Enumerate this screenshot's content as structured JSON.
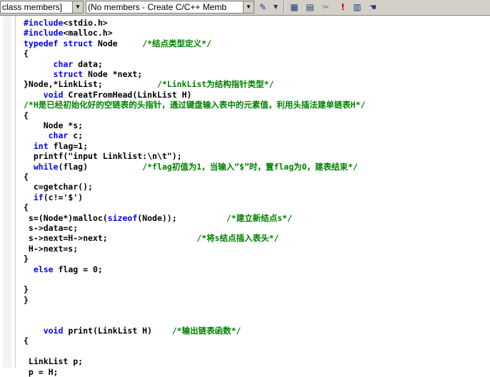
{
  "toolbar": {
    "class_combo": "class members]",
    "members_combo": "(No members - Create C/C++ Memb",
    "icons": [
      "wizard-icon",
      "dropdown-icon",
      "workspace-icon",
      "classwizard-icon",
      "stop-build-icon",
      "exclamation-icon",
      "report-icon",
      "hand-icon"
    ]
  },
  "colors": {
    "keyword": "#0000ff",
    "comment": "#008000",
    "text": "#000000"
  },
  "code_lines": [
    [
      {
        "t": "#include",
        "k": "kw"
      },
      {
        "t": "<stdio.h>"
      }
    ],
    [
      {
        "t": "#include",
        "k": "kw"
      },
      {
        "t": "<malloc.h>"
      }
    ],
    [
      {
        "t": "typedef",
        "k": "kw"
      },
      {
        "t": " "
      },
      {
        "t": "struct",
        "k": "kw"
      },
      {
        "t": " Node     "
      },
      {
        "t": "/*结点类型定义*/",
        "k": "cm"
      }
    ],
    [
      {
        "t": "{"
      }
    ],
    [
      {
        "t": "      "
      },
      {
        "t": "char",
        "k": "kw"
      },
      {
        "t": " data;"
      }
    ],
    [
      {
        "t": "      "
      },
      {
        "t": "struct",
        "k": "kw"
      },
      {
        "t": " Node *next;"
      }
    ],
    [
      {
        "t": "}Node,*LinkList;           "
      },
      {
        "t": "/*LinkList为结构指针类型*/",
        "k": "cm"
      }
    ],
    [
      {
        "t": "    "
      },
      {
        "t": "void",
        "k": "kw"
      },
      {
        "t": " CreatFromHead(LinkList H)"
      }
    ],
    [
      {
        "t": "/*H是已经初始化好的空链表的头指针，通过键盘输入表中的元素值，利用头插法建单链表H*/",
        "k": "cm"
      }
    ],
    [
      {
        "t": "{"
      }
    ],
    [
      {
        "t": "    Node *s;"
      }
    ],
    [
      {
        "t": "     "
      },
      {
        "t": "char",
        "k": "kw"
      },
      {
        "t": " c;"
      }
    ],
    [
      {
        "t": "  "
      },
      {
        "t": "int",
        "k": "kw"
      },
      {
        "t": " flag=1;"
      }
    ],
    [
      {
        "t": "  printf(\"input Linklist:\\n\\t\");"
      }
    ],
    [
      {
        "t": "  "
      },
      {
        "t": "while",
        "k": "kw"
      },
      {
        "t": "(flag)           "
      },
      {
        "t": "/*flag初值为1，当输入“$”时，置flag为0，建表结束*/",
        "k": "cm"
      }
    ],
    [
      {
        "t": "{"
      }
    ],
    [
      {
        "t": "  c=getchar();"
      }
    ],
    [
      {
        "t": "  "
      },
      {
        "t": "if",
        "k": "kw"
      },
      {
        "t": "(c!='$')"
      }
    ],
    [
      {
        "t": "{"
      }
    ],
    [
      {
        "t": " s=(Node*)malloc("
      },
      {
        "t": "sizeof",
        "k": "kw"
      },
      {
        "t": "(Node));          "
      },
      {
        "t": "/*建立新结点s*/",
        "k": "cm"
      }
    ],
    [
      {
        "t": " s->data=c;"
      }
    ],
    [
      {
        "t": " s->next=H->next;                  "
      },
      {
        "t": "/*将s结点插入表头*/",
        "k": "cm"
      }
    ],
    [
      {
        "t": " H->next=s;"
      }
    ],
    [
      {
        "t": "}"
      }
    ],
    [
      {
        "t": "  "
      },
      {
        "t": "else",
        "k": "kw"
      },
      {
        "t": " flag = 0;"
      }
    ],
    [],
    [
      {
        "t": "}"
      }
    ],
    [
      {
        "t": "}"
      }
    ],
    [],
    [],
    [
      {
        "t": "    "
      },
      {
        "t": "void",
        "k": "kw"
      },
      {
        "t": " print(LinkList H)    "
      },
      {
        "t": "/*输出链表函数*/",
        "k": "cm"
      }
    ],
    [
      {
        "t": "{"
      }
    ],
    [],
    [
      {
        "t": " LinkList p;"
      }
    ],
    [
      {
        "t": " p = H;"
      }
    ]
  ]
}
